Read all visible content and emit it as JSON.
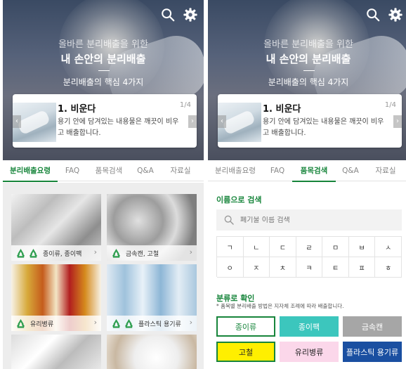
{
  "hero": {
    "subtitle": "올바른 분리배출을 위한",
    "title": "내 손안의 분리배출",
    "core": "분리배출의 핵심 4가지"
  },
  "slide": {
    "title": "1. 비운다",
    "counter": "1/4",
    "desc": "용기 안에 담겨있는 내용물은 깨끗이 비우고 배출합니다."
  },
  "tabs": [
    "분리배출요령",
    "FAQ",
    "품목검색",
    "Q&A",
    "자료실"
  ],
  "left_active_tab": "분리배출요령",
  "right_active_tab": "품목검색",
  "categories_grid": [
    {
      "label": "종이류, 종이팩",
      "icons": [
        "종이",
        "종이팩"
      ]
    },
    {
      "label": "금속캔, 고철",
      "icons": [
        "캔류"
      ]
    },
    {
      "label": "유리병류",
      "icons": [
        "유리"
      ]
    },
    {
      "label": "플라스틱 용기류",
      "icons": [
        "페트",
        "플라"
      ]
    },
    {
      "label": "",
      "icons": []
    },
    {
      "label": "",
      "icons": []
    }
  ],
  "search": {
    "heading": "이름으로 검색",
    "placeholder": "폐기물 이름 검색",
    "consonants_row1": [
      "ㄱ",
      "ㄴ",
      "ㄷ",
      "ㄹ",
      "ㅁ",
      "ㅂ",
      "ㅅ"
    ],
    "consonants_row2": [
      "ㅇ",
      "ㅈ",
      "ㅊ",
      "ㅋ",
      "ㅌ",
      "ㅍ",
      "ㅎ"
    ]
  },
  "classify": {
    "heading": "분류로 확인",
    "note": "* 품목별 분리배출 방법은 지자체 조례에 따라 배출합니다.",
    "buttons": [
      {
        "label": "종이류",
        "bg": "#ffffff",
        "fg": "#17853b",
        "border": "#17853b"
      },
      {
        "label": "종이팩",
        "bg": "#3cc6bd",
        "fg": "#ffffff",
        "border": "#3cc6bd"
      },
      {
        "label": "금속캔",
        "bg": "#a6a6a6",
        "fg": "#ffffff",
        "border": "#a6a6a6"
      },
      {
        "label": "고철",
        "bg": "#ffef00",
        "fg": "#222222",
        "border": "#17853b"
      },
      {
        "label": "유리병류",
        "bg": "#fbd7ea",
        "fg": "#222222",
        "border": "#fbd7ea"
      },
      {
        "label": "플라스틱 용기류",
        "bg": "#1a4fa1",
        "fg": "#ffffff",
        "border": "#1a4fa1"
      }
    ]
  },
  "colors": {
    "accent": "#17853b",
    "recycle_icon": "#2e9e4f",
    "hero_dark": "#3a4a63"
  },
  "icons": [
    "search-icon",
    "gear-icon",
    "chevron-left-icon",
    "chevron-right-icon",
    "recycle-icon"
  ]
}
